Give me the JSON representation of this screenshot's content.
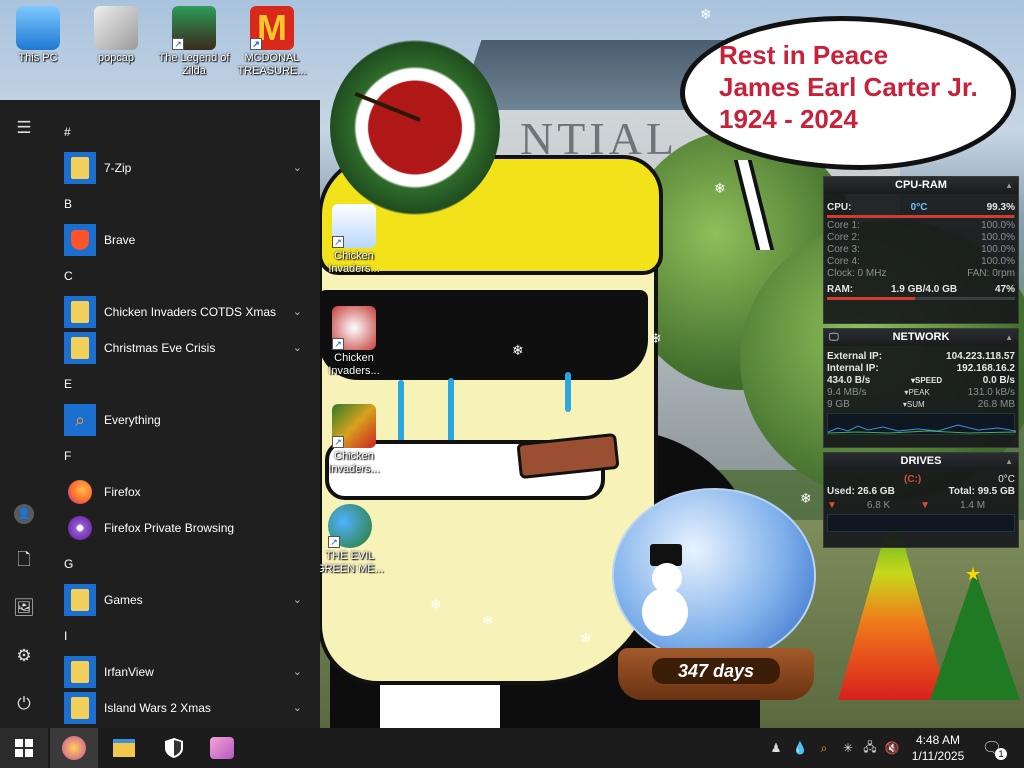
{
  "desktop": {
    "icons": [
      {
        "label": "This PC",
        "icon": "this-pc-icon"
      },
      {
        "label": "popcap",
        "icon": "popcap-icon"
      },
      {
        "label": "The Legend of Zilda",
        "icon": "legend-of-zilda-icon"
      },
      {
        "label": "MCDONAL TREASURE...",
        "icon": "mcdonalds-icon"
      },
      {
        "label": "Chicken Invaders...",
        "icon": "chicken-invaders-icon"
      },
      {
        "label": "Chicken Invaders...",
        "icon": "chicken-invaders-icon"
      },
      {
        "label": "Chicken Invaders...",
        "icon": "chicken-invaders-icon"
      },
      {
        "label": "THE EVIL GREEN ME...",
        "icon": "msn-messenger-icon"
      }
    ],
    "speech_bubble": [
      "Rest in Peace",
      "James Earl Carter Jr.",
      "1924 - 2024"
    ],
    "snow_globe_label": "347 days"
  },
  "gadgets": {
    "cpu_ram": {
      "title": "CPU-RAM",
      "cpu_label": "CPU:",
      "cpu_temp": "0°C",
      "cpu_value": "99.3%",
      "cores": [
        {
          "label": "Core 1:",
          "value": "100.0%"
        },
        {
          "label": "Core 2:",
          "value": "100.0%"
        },
        {
          "label": "Core 3:",
          "value": "100.0%"
        },
        {
          "label": "Core 4:",
          "value": "100.0%"
        }
      ],
      "clock": "Clock: 0 MHz",
      "fan": "FAN: 0rpm",
      "ram_label": "RAM:",
      "ram_used": "1.9 GB/4.0 GB",
      "ram_pct": "47%",
      "cpu_fill": 0.993,
      "ram_fill": 0.47
    },
    "network": {
      "title": "NETWORK",
      "external_label": "External IP:",
      "external_ip": "104.223.118.57",
      "internal_label": "Internal IP:",
      "internal_ip": "192.168.16.2",
      "rows": [
        {
          "left": "434.0 B/s",
          "mid": "SPEED",
          "right": "0.0 B/s"
        },
        {
          "left": "9.4 MB/s",
          "mid": "PEAK",
          "right": "131.0 kB/s"
        },
        {
          "left": "9 GB",
          "mid": "SUM",
          "right": "26.8 MB"
        }
      ]
    },
    "drives": {
      "title": "DRIVES",
      "drive": "(C:)",
      "temp": "0°C",
      "used": "Used: 26.6 GB",
      "total": "Total: 99.5 GB",
      "read": "6.8 K",
      "write": "1.4 M"
    }
  },
  "start_menu": {
    "groups": [
      {
        "letter": "#",
        "items": [
          {
            "label": "7-Zip",
            "icon": "folder-icon",
            "expandable": true
          }
        ]
      },
      {
        "letter": "B",
        "items": [
          {
            "label": "Brave",
            "icon": "brave-icon",
            "expandable": false
          }
        ]
      },
      {
        "letter": "C",
        "items": [
          {
            "label": "Chicken Invaders COTDS Xmas",
            "icon": "folder-icon",
            "expandable": true
          },
          {
            "label": "Christmas Eve Crisis",
            "icon": "folder-icon",
            "expandable": true
          }
        ]
      },
      {
        "letter": "E",
        "items": [
          {
            "label": "Everything",
            "icon": "everything-search-icon",
            "expandable": false
          }
        ]
      },
      {
        "letter": "F",
        "items": [
          {
            "label": "Firefox",
            "icon": "firefox-icon",
            "expandable": false
          },
          {
            "label": "Firefox Private Browsing",
            "icon": "firefox-private-icon",
            "expandable": false
          }
        ]
      },
      {
        "letter": "G",
        "items": [
          {
            "label": "Games",
            "icon": "folder-icon",
            "expandable": true
          }
        ]
      },
      {
        "letter": "I",
        "items": [
          {
            "label": "IrfanView",
            "icon": "folder-icon",
            "expandable": true
          },
          {
            "label": "Island Wars 2 Xmas",
            "icon": "folder-icon",
            "expandable": true
          }
        ]
      }
    ]
  },
  "taskbar": {
    "time": "4:48 AM",
    "date": "1/11/2025",
    "notification_count": "1",
    "colors": {
      "taskbar": "#1c1c1c",
      "start_menu": "#1f1f1f",
      "tile": "#1b6fd1",
      "accent_red": "#c8213a"
    }
  }
}
